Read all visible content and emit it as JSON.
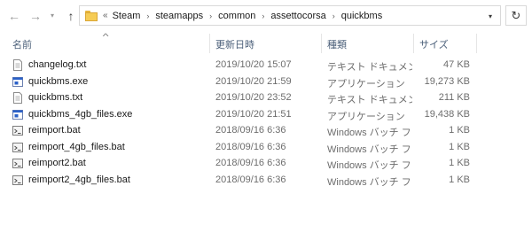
{
  "nav": {
    "back_icon": "arrow-left-icon",
    "forward_icon": "arrow-right-icon",
    "recent_icon": "chevron-down-icon",
    "up_icon": "arrow-up-icon",
    "refresh_icon": "refresh-icon"
  },
  "address": {
    "overflow": "«",
    "crumbs": [
      "Steam",
      "steamapps",
      "common",
      "assettocorsa",
      "quickbms"
    ],
    "separator": "›"
  },
  "columns": {
    "name": "名前",
    "date": "更新日時",
    "type": "種類",
    "size": "サイズ"
  },
  "files": [
    {
      "name": "changelog.txt",
      "date": "2019/10/20 15:07",
      "type": "テキスト ドキュメント",
      "size": "47 KB",
      "icon": "text-file-icon"
    },
    {
      "name": "quickbms.exe",
      "date": "2019/10/20 21:59",
      "type": "アプリケーション",
      "size": "19,273 KB",
      "icon": "application-icon"
    },
    {
      "name": "quickbms.txt",
      "date": "2019/10/20 23:52",
      "type": "テキスト ドキュメント",
      "size": "211 KB",
      "icon": "text-file-icon"
    },
    {
      "name": "quickbms_4gb_files.exe",
      "date": "2019/10/20 21:51",
      "type": "アプリケーション",
      "size": "19,438 KB",
      "icon": "application-icon"
    },
    {
      "name": "reimport.bat",
      "date": "2018/09/16 6:36",
      "type": "Windows バッチ ファ...",
      "size": "1 KB",
      "icon": "batch-file-icon"
    },
    {
      "name": "reimport_4gb_files.bat",
      "date": "2018/09/16 6:36",
      "type": "Windows バッチ ファ...",
      "size": "1 KB",
      "icon": "batch-file-icon"
    },
    {
      "name": "reimport2.bat",
      "date": "2018/09/16 6:36",
      "type": "Windows バッチ ファ...",
      "size": "1 KB",
      "icon": "batch-file-icon"
    },
    {
      "name": "reimport2_4gb_files.bat",
      "date": "2018/09/16 6:36",
      "type": "Windows バッチ ファ...",
      "size": "1 KB",
      "icon": "batch-file-icon"
    }
  ],
  "colors": {
    "header_text": "#4c607a",
    "folder": "#f6cc55",
    "exe_accent": "#2b61c9"
  }
}
